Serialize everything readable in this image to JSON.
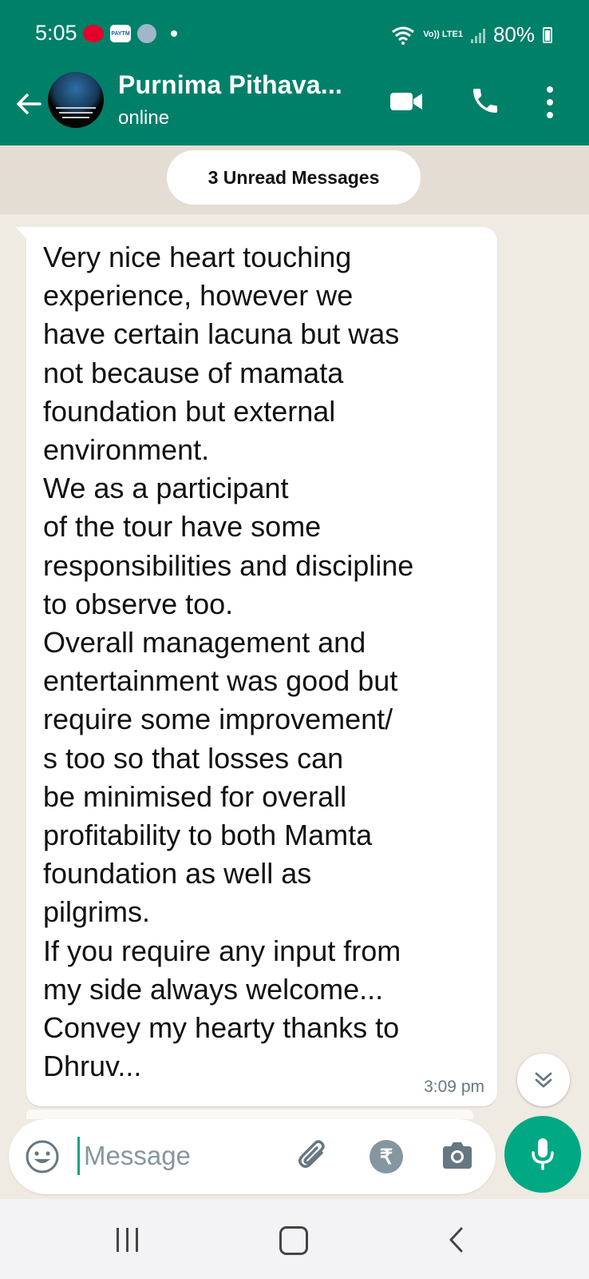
{
  "status_bar": {
    "time": "5:05",
    "app_badge": "PAYTM",
    "network": "Vo)) LTE1",
    "battery": "80%"
  },
  "header": {
    "contact_name": "Purnima Pithava...",
    "contact_status": "online"
  },
  "chat": {
    "unread_label": "3 Unread Messages",
    "message": {
      "text": "Very nice heart touching\nexperience, however we\nhave certain lacuna but was\nnot because of mamata\nfoundation but external\nenvironment.\nWe as a participant\nof the tour have some\nresponsibilities and discipline\nto observe too.\nOverall management and\nentertainment was good but\nrequire some improvement/\ns too so that losses can\nbe minimised for overall\nprofitability to both Mamta\nfoundation as well as\npilgrims.\nIf you require any input from\nmy side always welcome...\nConvey my hearty thanks to\nDhruv...",
      "time": "3:09 pm"
    }
  },
  "composer": {
    "placeholder": "Message",
    "rupee_symbol": "₹"
  },
  "colors": {
    "brand": "#008069",
    "accent": "#00a884",
    "chat_background": "#efeae2"
  },
  "icons": [
    "back-arrow-icon",
    "video-call-icon",
    "phone-icon",
    "more-options-icon",
    "scroll-down-icon",
    "emoji-icon",
    "attach-icon",
    "rupee-icon",
    "camera-icon",
    "mic-icon"
  ]
}
